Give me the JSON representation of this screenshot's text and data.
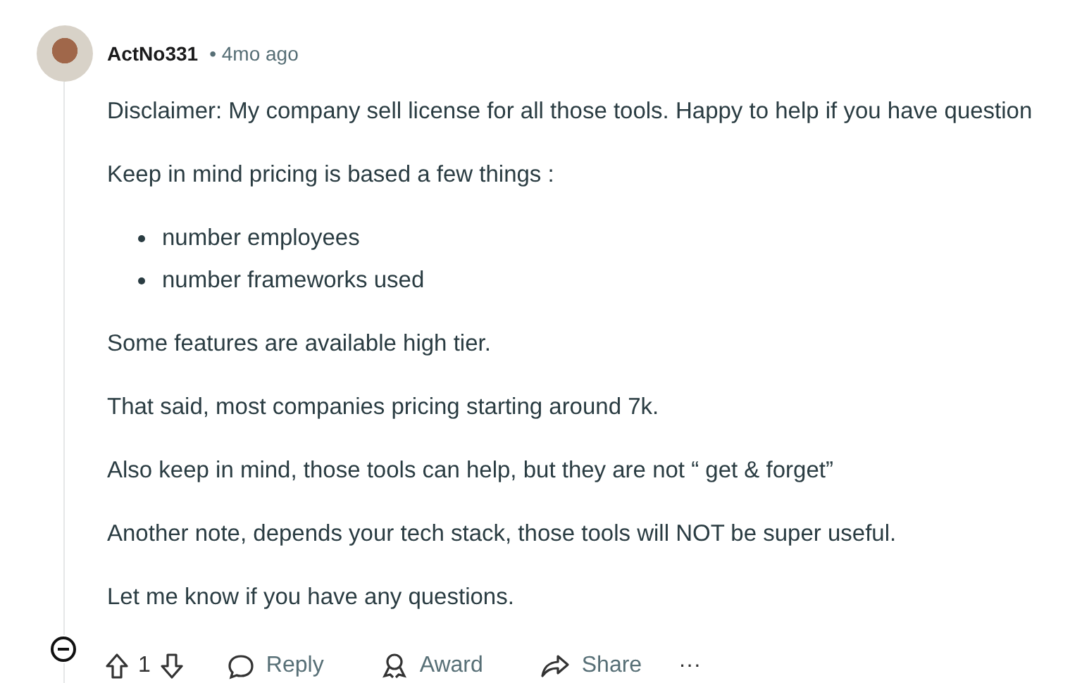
{
  "comment": {
    "author": "ActNo331",
    "age": "• 4mo ago",
    "body": [
      {
        "kind": "paragraph",
        "text": "Disclaimer: My company sell license for all those tools. Happy to help if you have question"
      },
      {
        "kind": "paragraph",
        "text": "Keep in mind pricing is based a few things :"
      },
      {
        "kind": "list",
        "items": [
          "number employees",
          "number frameworks used"
        ]
      },
      {
        "kind": "paragraph",
        "text": "Some features are available high tier."
      },
      {
        "kind": "paragraph",
        "text": "That said, most companies pricing starting around 7k."
      },
      {
        "kind": "paragraph",
        "text": "Also keep in mind, those tools can help, but they are not “ get & forget”"
      },
      {
        "kind": "paragraph",
        "text": "Another note, depends your tech stack, those tools will NOT be super useful."
      },
      {
        "kind": "paragraph",
        "text": "Let me know if you have any questions."
      }
    ]
  },
  "actions": {
    "score": "1",
    "reply": "Reply",
    "award": "Award",
    "share": "Share",
    "more": "···"
  }
}
